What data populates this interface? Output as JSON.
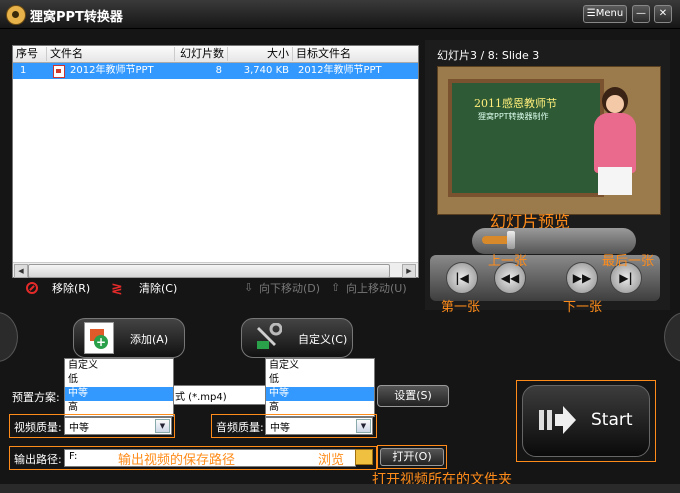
{
  "window": {
    "title": "狸窝PPT转换器",
    "menu_label": "☰Menu",
    "minimize_label": "—",
    "close_label": "✕"
  },
  "file_list": {
    "columns": [
      "序号",
      "文件名",
      "幻灯片数",
      "大小",
      "目标文件名"
    ],
    "rows": [
      {
        "index": "1",
        "filename": "2012年教师节PPT",
        "slides": "8",
        "size": "3,740 KB",
        "target": "2012年教师节PPT"
      }
    ]
  },
  "list_actions": {
    "remove": "移除(R)",
    "clear": "清除(C)",
    "move_down": "向下移动(D)",
    "move_up": "向上移动(U)"
  },
  "preview": {
    "label": "幻灯片3 / 8: Slide 3",
    "slide_title": "2011感恩教师节",
    "slide_subtitle": "狸窝PPT转换器制作",
    "caption": "幻灯片预览",
    "progress": 0.2,
    "nav": {
      "first_label": "第一张",
      "prev_label": "上一张",
      "next_label": "下一张",
      "last_label": "最后一张"
    }
  },
  "buttons": {
    "add": "添加(A)",
    "custom": "自定义(C)",
    "settings": "设置(S)",
    "open": "打开(O)",
    "start": "Start"
  },
  "preset": {
    "label": "预置方案:",
    "value": "式 (*.mp4)"
  },
  "video_quality": {
    "label": "视频质量:",
    "value": "中等",
    "options": [
      "自定义",
      "低",
      "中等",
      "高"
    ],
    "selected": "中等"
  },
  "audio_quality": {
    "label": "音频质量:",
    "value": "中等",
    "options": [
      "自定义",
      "低",
      "中等",
      "高"
    ],
    "selected": "中等"
  },
  "output": {
    "label": "输出路径:",
    "value": "F:",
    "hint": "输出视频的保存路径",
    "browse_label": "浏览",
    "open_hint": "打开视频所在的文件夹"
  },
  "colors": {
    "accent": "#ff8c1a",
    "selection": "#3399ff"
  }
}
